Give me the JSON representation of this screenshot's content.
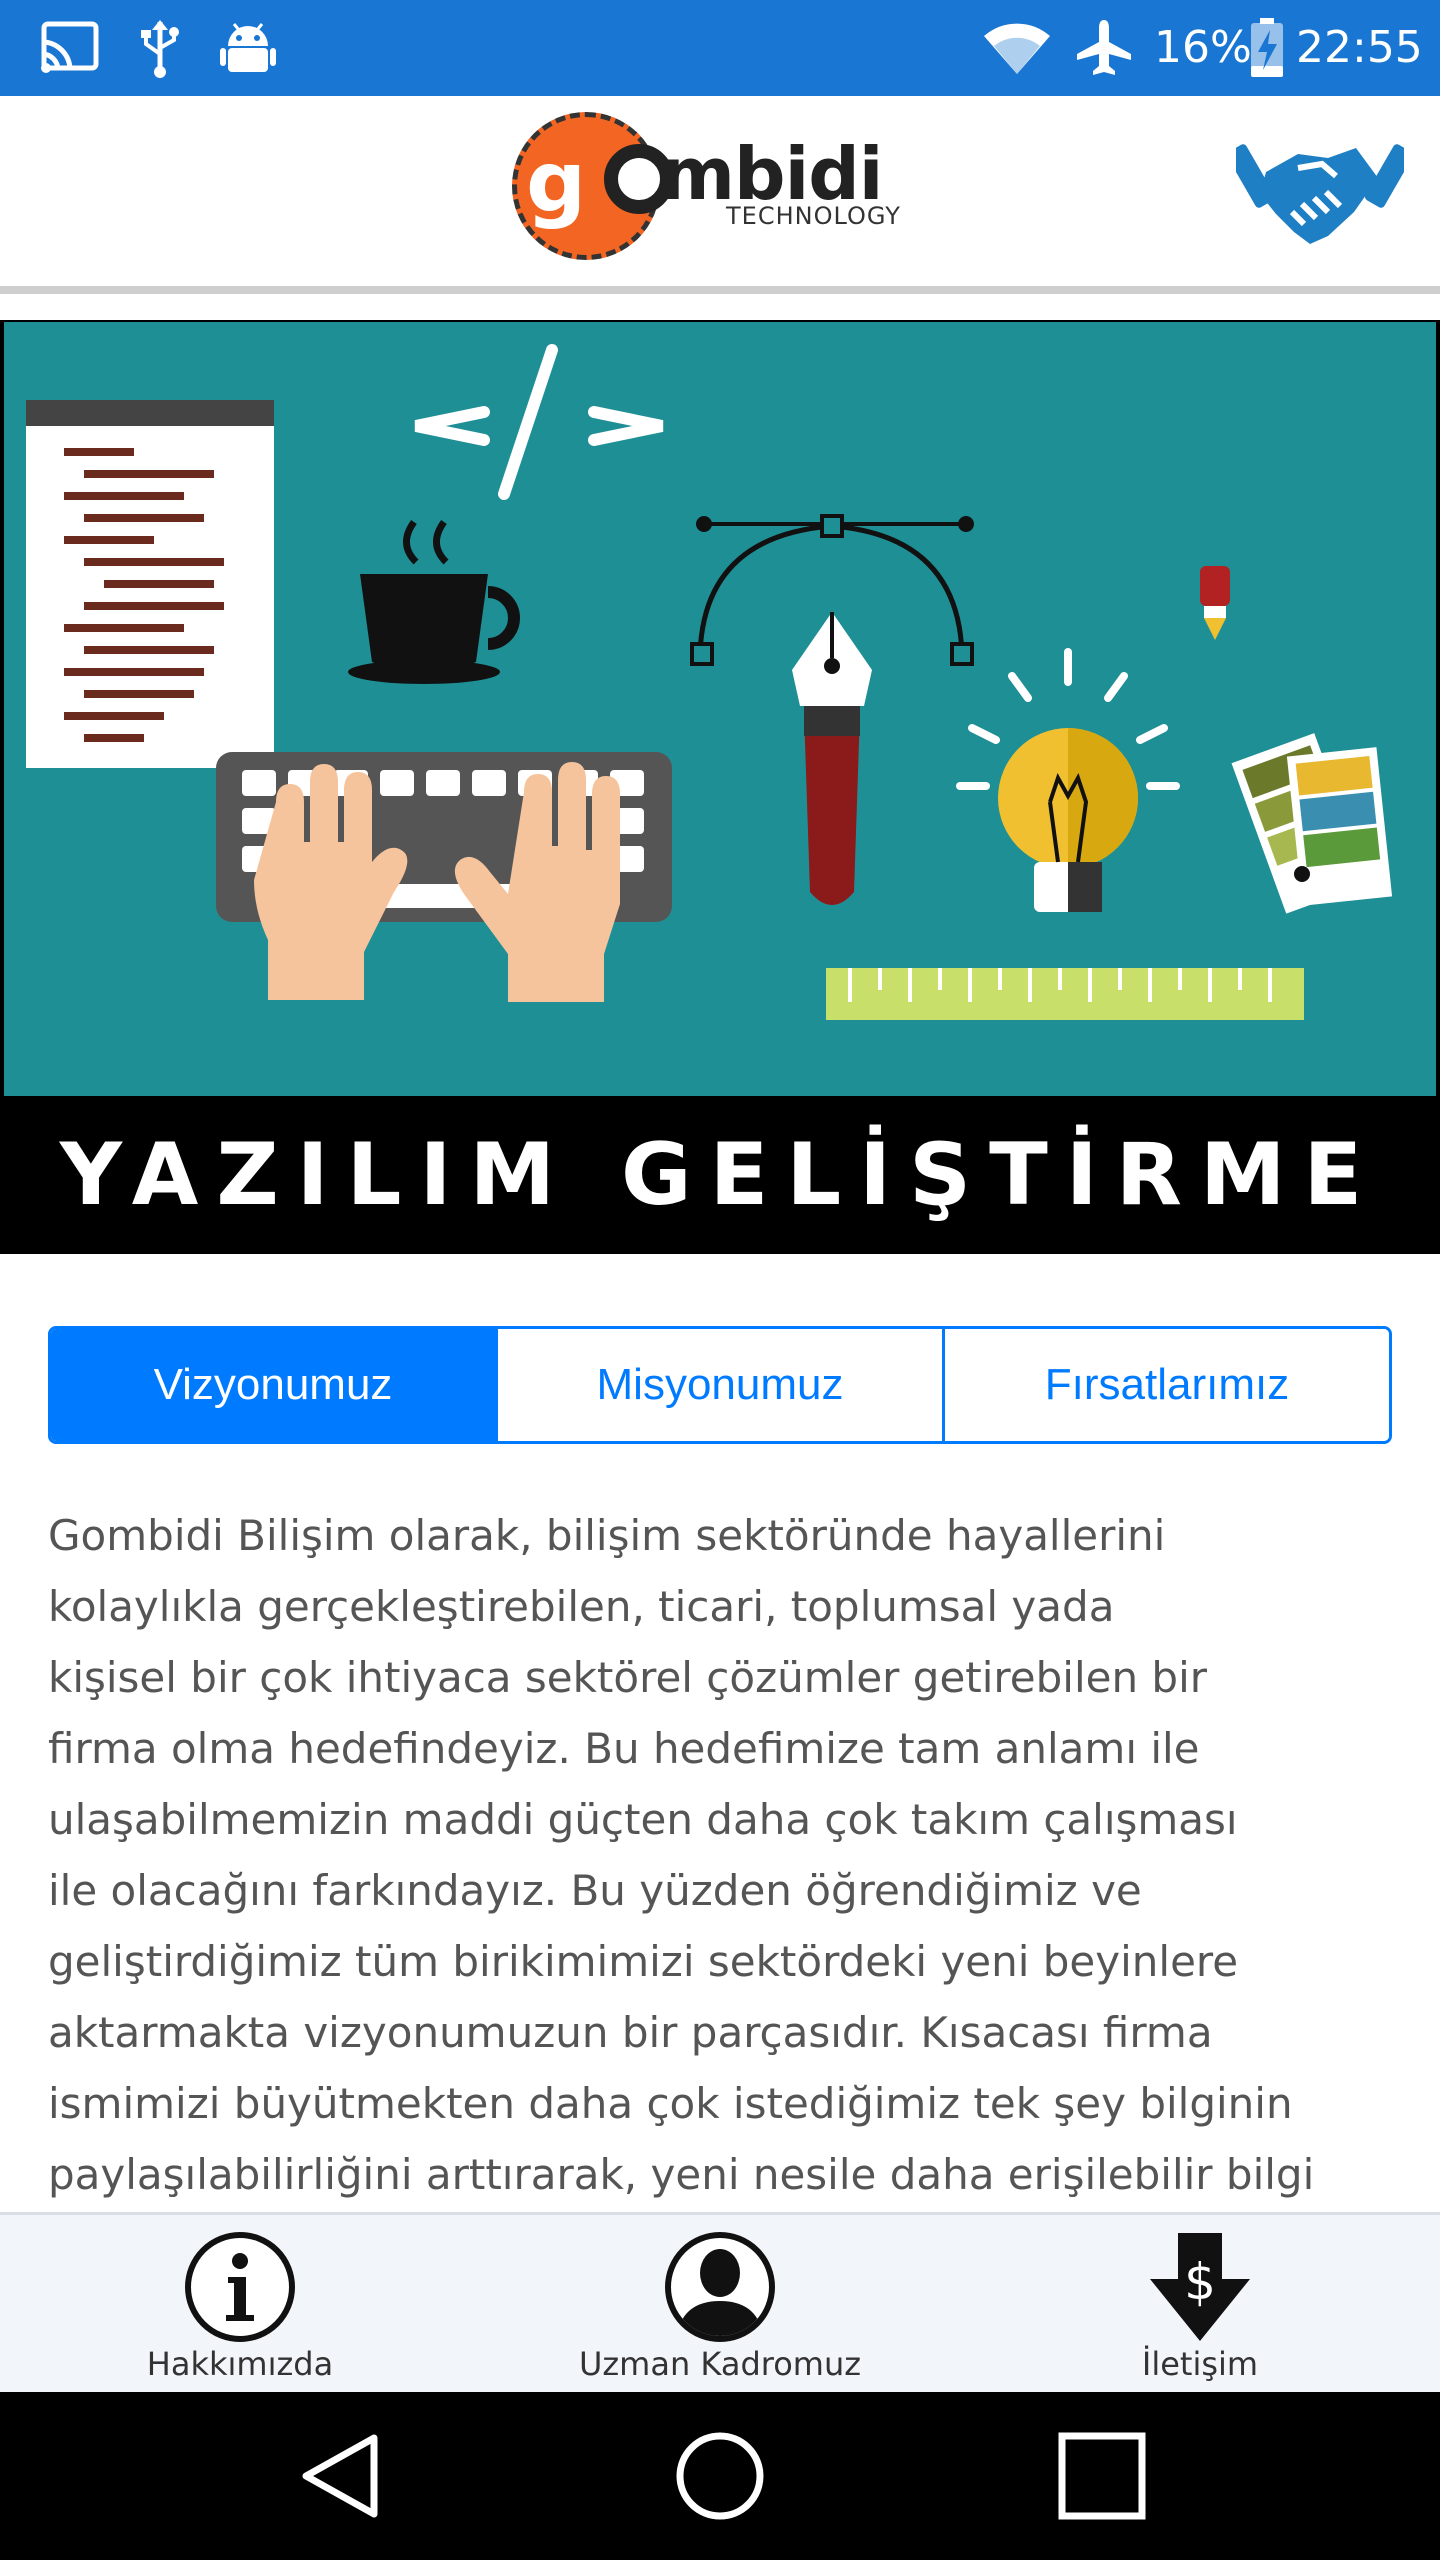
{
  "status_bar": {
    "battery": "16%",
    "time": "22:55",
    "icons": [
      "cast-icon",
      "usb-icon",
      "android-icon",
      "wifi-icon",
      "airplane-icon",
      "battery-charging-icon"
    ]
  },
  "header": {
    "logo_word": "mbidi",
    "logo_prefix": "g",
    "logo_sub": "TECHNOLOGY",
    "action_icon": "handshake-icon"
  },
  "banner": {
    "title": "YAZILIM GELİŞTİRME"
  },
  "tabs": [
    {
      "label": "Vizyonumuz",
      "active": true
    },
    {
      "label": "Misyonumuz",
      "active": false
    },
    {
      "label": "Fırsatlarımız",
      "active": false
    }
  ],
  "content": {
    "lines": [
      "Gombidi Bilişim olarak, bilişim sektöründe hayallerini",
      "kolaylıkla gerçekleştirebilen, ticari, toplumsal yada",
      "kişisel bir çok ihtiyaca sektörel çözümler getirebilen bir",
      "firma olma hedefindeyiz. Bu hedefimize tam anlamı ile",
      "ulaşabilmemizin maddi güçten daha çok takım çalışması",
      "ile olacağını farkındayız. Bu yüzden öğrendiğimiz ve",
      "geliştirdiğimiz tüm birikimimizi sektördeki yeni beyinlere",
      "aktarmakta vizyonumuzun bir parçasıdır. Kısacası firma",
      "ismimizi büyütmekten daha çok istediğimiz tek şey bilginin",
      "paylaşılabilirliğini arttırarak, yeni nesile daha erişilebilir bilgi"
    ]
  },
  "bottom_nav": [
    {
      "label": "Hakkımızda",
      "icon": "info-icon"
    },
    {
      "label": "Uzman Kadromuz",
      "icon": "person-icon"
    },
    {
      "label": "İletişim",
      "icon": "dollar-download-icon"
    }
  ],
  "system_nav": [
    "back-icon",
    "home-icon",
    "recents-icon"
  ],
  "colors": {
    "status_bar": "#1976d2",
    "accent": "#007bff",
    "logo_orange": "#f26522",
    "banner_teal": "#1f8f96"
  }
}
